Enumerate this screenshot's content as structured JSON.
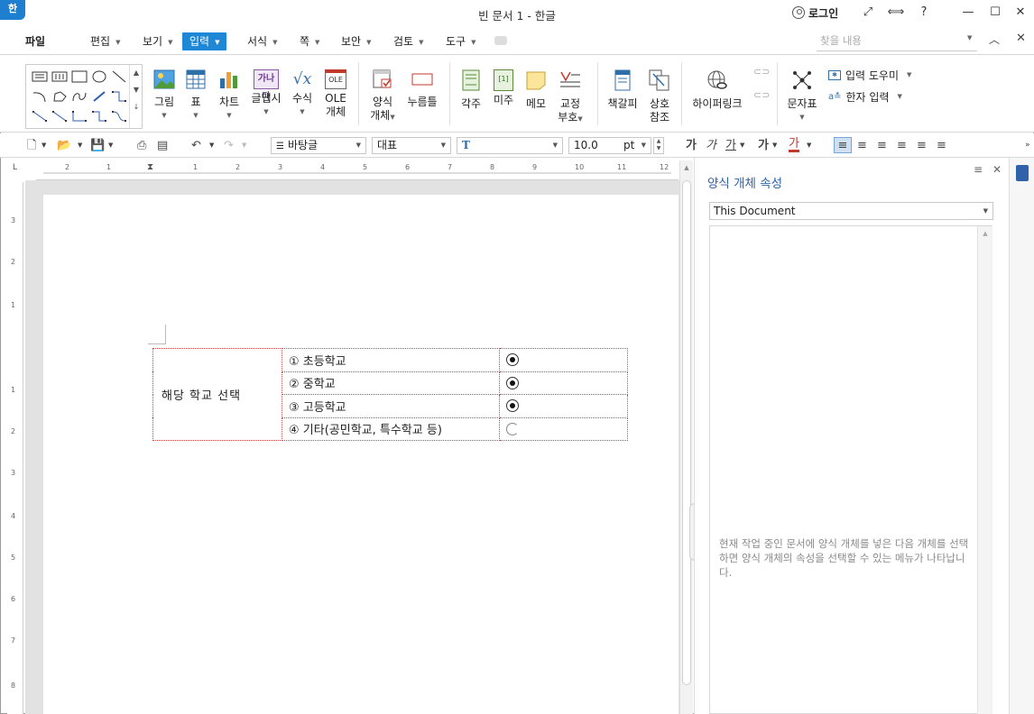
{
  "app": {
    "logo": "한",
    "title": "빈 문서 1 - 한글",
    "login": "로그인"
  },
  "titlebar": {
    "fullscreen_icon": "⤢",
    "split_icon": "⟺",
    "help": "?",
    "minimize": "—",
    "maximize": "☐",
    "close": "✕"
  },
  "menus": [
    {
      "label": "파일"
    },
    {
      "label": "편집"
    },
    {
      "label": "보기"
    },
    {
      "label": "입력"
    },
    {
      "label": "서식"
    },
    {
      "label": "쪽"
    },
    {
      "label": "보안"
    },
    {
      "label": "검토"
    },
    {
      "label": "도구"
    }
  ],
  "search": {
    "placeholder": "찾을 내용"
  },
  "ribbon": {
    "image": "그림",
    "table": "표",
    "chart": "차트",
    "wordart": "글맵시",
    "wordart_icon": "가나다",
    "formula": "수식",
    "formula_icon": "√x",
    "ole1": "OLE",
    "ole2": "개체",
    "ole_icon": "OLE",
    "form1": "양식",
    "form2": "개체",
    "button": "누름틀",
    "footnote": "각주",
    "endnote": "미주",
    "endnote_icon": "[1]",
    "memo": "메모",
    "proof1": "교정",
    "proof2": "부호",
    "bookmark": "책갈피",
    "crossref1": "상호",
    "crossref2": "참조",
    "hyperlink": "하이퍼링크",
    "symbol": "문자표",
    "input_helper": "입력 도우미",
    "hanja_input": "한자 입력",
    "hanja_icon": "a≛"
  },
  "format": {
    "style": "바탕글",
    "font_lang": "대표",
    "font_name": "T",
    "font_size": "10.0",
    "unit": "pt",
    "bold": "가",
    "italic": "가",
    "underline": "가",
    "strike": "가",
    "color": "가"
  },
  "ruler": {
    "marks": [
      "2",
      "1",
      "1",
      "2",
      "3",
      "4",
      "5",
      "6",
      "7",
      "8",
      "9",
      "10",
      "11",
      "12"
    ]
  },
  "vruler": {
    "marks": [
      "3",
      "2",
      "1",
      "1",
      "2",
      "3",
      "4",
      "5",
      "6",
      "7",
      "8"
    ]
  },
  "form": {
    "label": "해당 학교 선택",
    "options": [
      {
        "text": "① 초등학교",
        "selected": true
      },
      {
        "text": "② 중학교",
        "selected": true
      },
      {
        "text": "③ 고등학교",
        "selected": true
      },
      {
        "text": "④ 기타(공민학교, 특수학교 등)",
        "selected": false
      }
    ]
  },
  "sidepanel": {
    "title": "양식 개체 속성",
    "combo_value": "This Document",
    "hint": "현재 작업 중인 문서에 양식 개체를 넣은 다음 개체를 선택하면 양식 개체의 속성을 선택할 수 있는 메뉴가 나타납니다."
  },
  "colors": {
    "accent": "#1e88d6",
    "panel_title": "#2f62a8",
    "form_border": "#d34545"
  }
}
